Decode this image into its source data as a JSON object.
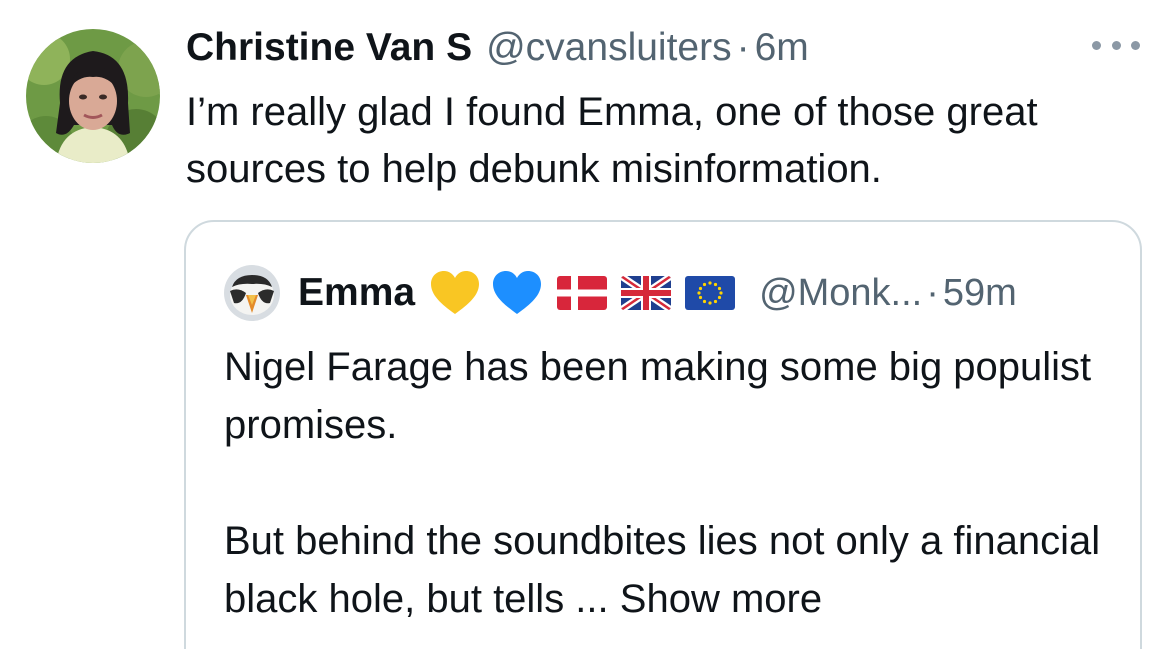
{
  "tweet": {
    "author_name": "Christine Van S",
    "handle": "@cvansluiters",
    "separator": "·",
    "time": "6m",
    "text": "I’m really glad I found Emma, one of those great sources to help debunk misinformation.",
    "avatar_icon": "profile-photo",
    "more_icon": "more-horizontal-icon"
  },
  "quoted": {
    "author_name": "Emma",
    "handle": "@Monk...",
    "separator": "·",
    "time": "59m",
    "paragraph1": "Nigel Farage has been making some big populist promises.",
    "paragraph2": "But behind the soundbites lies not only a financial black hole, but tells ...",
    "show_more": "Show more",
    "badges": [
      "yellow-heart-icon",
      "blue-heart-icon",
      "denmark-flag-icon",
      "uk-flag-icon",
      "eu-flag-icon"
    ]
  },
  "colors": {
    "text_primary": "#0f1419",
    "text_secondary": "#536471",
    "border": "#cfd9de",
    "heart_yellow": "#f9c623",
    "heart_blue": "#1d8fff"
  }
}
